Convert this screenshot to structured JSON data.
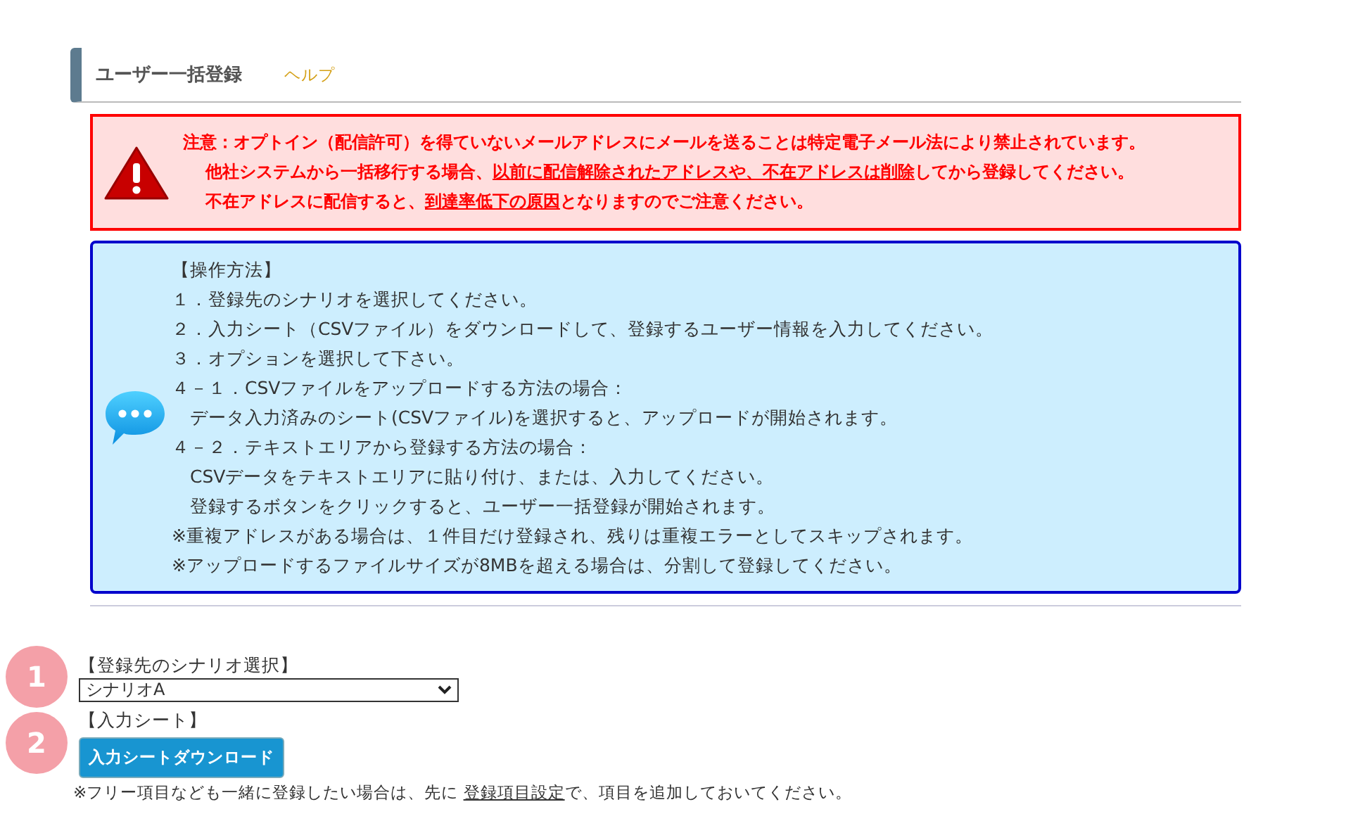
{
  "header": {
    "title": "ユーザー一括登録",
    "help_link": "ヘルプ"
  },
  "warning": {
    "lines": [
      [
        {
          "text": "注意：オプトイン（配信許可）を得ていないメールアドレスにメールを送ることは特定電子メール法により禁止されています。",
          "link": false
        }
      ],
      [
        {
          "text": "他社システムから一括移行する場合、",
          "link": false
        },
        {
          "text": "以前に配信解除されたアドレスや、不在アドレスは削除",
          "link": true
        },
        {
          "text": "してから登録してください。",
          "link": false
        }
      ],
      [
        {
          "text": "不在アドレスに配信すると、",
          "link": false
        },
        {
          "text": "到達率低下の原因",
          "link": true
        },
        {
          "text": "となりますのでご注意ください。",
          "link": false
        }
      ]
    ]
  },
  "instructions": {
    "lines": [
      "【操作方法】",
      "１．登録先のシナリオを選択してください。",
      "２．入力シート（CSVファイル）をダウンロードして、登録するユーザー情報を入力してください。",
      "３．オプションを選択して下さい。",
      "４－１．CSVファイルをアップロードする方法の場合：",
      "　データ入力済みのシート(CSVファイル)を選択すると、アップロードが開始されます。",
      "４－２．テキストエリアから登録する方法の場合：",
      "　CSVデータをテキストエリアに貼り付け、または、入力してください。",
      "　登録するボタンをクリックすると、ユーザー一括登録が開始されます。",
      "※重複アドレスがある場合は、１件目だけ登録され、残りは重複エラーとしてスキップされます。",
      "※アップロードするファイルサイズが8MBを超える場合は、分割して登録してください。"
    ]
  },
  "steps": [
    {
      "number": "1",
      "label": "【登録先のシナリオ選択】",
      "kind": "select",
      "value": "シナリオA"
    },
    {
      "number": "2",
      "label": "【入力シート】",
      "kind": "button",
      "button": "入力シートダウンロード"
    }
  ],
  "note": {
    "before": "※フリー項目なども一緒に登録したい場合は、先に ",
    "link": "登録項目設定",
    "after": "で、項目を追加しておいてください。"
  }
}
